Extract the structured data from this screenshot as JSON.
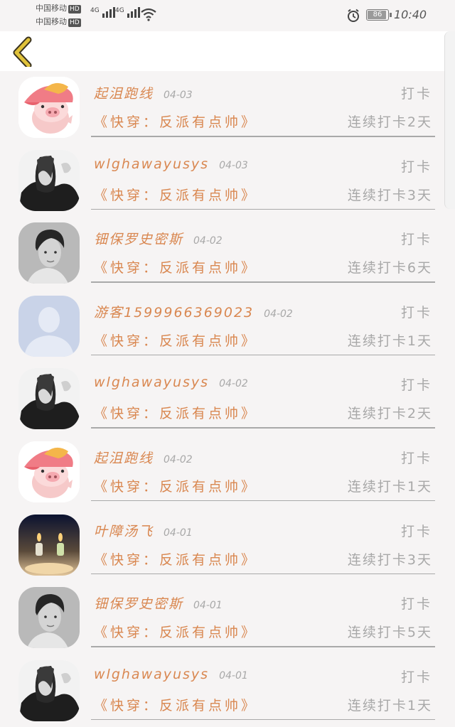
{
  "status_bar": {
    "carrier_1": "中国移动",
    "carrier_2": "中国移动",
    "hd": "HD",
    "network": "4G",
    "battery": "86",
    "time": "10:40"
  },
  "nav": {
    "back_icon": "chevron-left-icon",
    "accent": "#e0c23a"
  },
  "entries": [
    {
      "name": "起沮跑线",
      "date": "04-03",
      "action": "打卡",
      "title": "《快穿：反派有点帅》",
      "streak": "连续打卡2天",
      "avatar": "pig"
    },
    {
      "name": "wlghawayusys",
      "date": "04-03",
      "action": "打卡",
      "title": "《快穿：反派有点帅》",
      "streak": "连续打卡3天",
      "avatar": "dark"
    },
    {
      "name": "钿保罗史密斯",
      "date": "04-02",
      "action": "打卡",
      "title": "《快穿：反派有点帅》",
      "streak": "连续打卡6天",
      "avatar": "boy"
    },
    {
      "name": "游客15999663690​23",
      "date": "04-02",
      "action": "打卡",
      "title": "《快穿：反派有点帅》",
      "streak": "连续打卡1天",
      "avatar": "default"
    },
    {
      "name": "wlghawayusys",
      "date": "04-02",
      "action": "打卡",
      "title": "《快穿：反派有点帅》",
      "streak": "连续打卡2天",
      "avatar": "dark"
    },
    {
      "name": "起沮跑线",
      "date": "04-02",
      "action": "打卡",
      "title": "《快穿：反派有点帅》",
      "streak": "连续打卡1天",
      "avatar": "pig"
    },
    {
      "name": "叶障汤飞",
      "date": "04-01",
      "action": "打卡",
      "title": "《快穿：反派有点帅》",
      "streak": "连续打卡3天",
      "avatar": "candles"
    },
    {
      "name": "钿保罗史密斯",
      "date": "04-01",
      "action": "打卡",
      "title": "《快穿：反派有点帅》",
      "streak": "连续打卡5天",
      "avatar": "boy"
    },
    {
      "name": "wlghawayusys",
      "date": "04-01",
      "action": "打卡",
      "title": "《快穿：反派有点帅》",
      "streak": "连续打卡1天",
      "avatar": "dark"
    }
  ]
}
